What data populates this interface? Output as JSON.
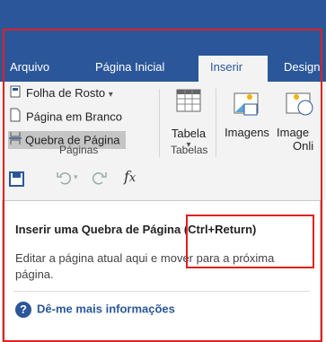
{
  "tabs": [
    {
      "label": "Arquivo"
    },
    {
      "label": "Página Inicial"
    },
    {
      "label": "Inserir"
    },
    {
      "label": "Design"
    }
  ],
  "ribbon": {
    "paginas": {
      "folha_de_rosto": "Folha de Rosto",
      "folha_de_rosto_dropdown": "▾",
      "pagina_em_branco": "Página em Branco",
      "quebra_de_pagina": "Quebra de Página",
      "group_label": "Páginas"
    },
    "tabelas": {
      "tabela": "Tabela",
      "tabela_dropdown": "▾",
      "group_label": "Tabelas"
    },
    "ilustracoes": {
      "imagens": "Imagens",
      "imagens_online_1": "Image",
      "imagens_online_2": "Onli"
    }
  },
  "tooltip": {
    "title": "Inserir uma Quebra de Página (Ctrl+Return)",
    "description": "Editar a página atual aqui e mover para a próxima página.",
    "help_link": "Dê-me mais informações",
    "help_icon": "?"
  },
  "colors": {
    "accent": "#2b579a",
    "highlight": "#e02020"
  }
}
